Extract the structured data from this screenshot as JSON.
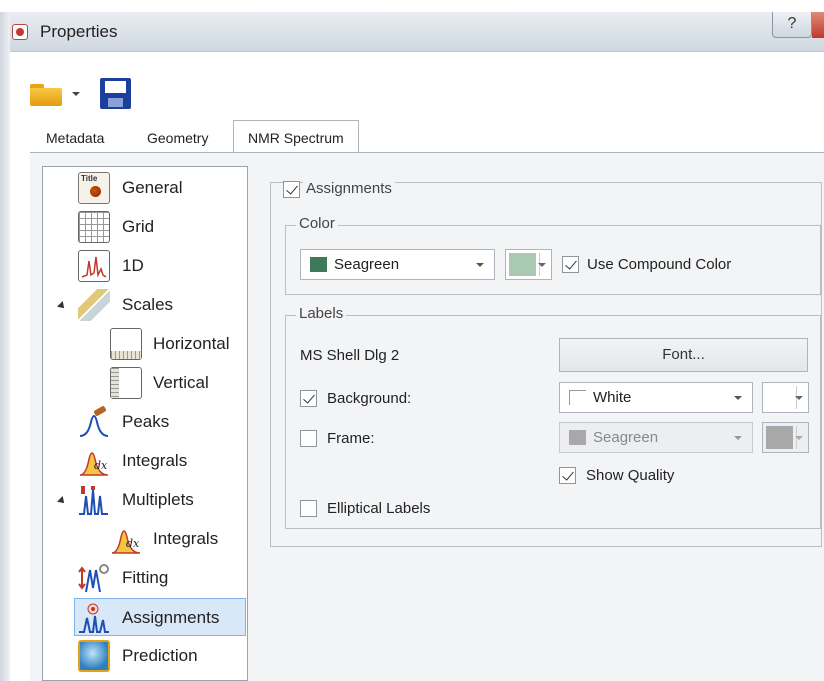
{
  "window": {
    "title": "Properties",
    "help_glyph": "?"
  },
  "toolbar": {
    "open_icon": "folder-open-icon",
    "save_icon": "save-icon"
  },
  "tabs": [
    {
      "label": "Metadata",
      "active": false
    },
    {
      "label": "Geometry",
      "active": false
    },
    {
      "label": "NMR Spectrum",
      "active": true
    }
  ],
  "tree": {
    "items": [
      {
        "label": "General",
        "icon": "title-icon"
      },
      {
        "label": "Grid",
        "icon": "grid-icon"
      },
      {
        "label": "1D",
        "icon": "spectrum-1d-icon"
      },
      {
        "label": "Scales",
        "icon": "rulers-icon",
        "expanded": true
      },
      {
        "label": "Horizontal",
        "icon": "ruler-horizontal-icon"
      },
      {
        "label": "Vertical",
        "icon": "ruler-vertical-icon"
      },
      {
        "label": "Peaks",
        "icon": "peak-pick-icon"
      },
      {
        "label": "Integrals",
        "icon": "integral-icon"
      },
      {
        "label": "Multiplets",
        "icon": "multiplet-icon",
        "expanded": true
      },
      {
        "label": "Integrals",
        "icon": "integral-icon"
      },
      {
        "label": "Fitting",
        "icon": "fitting-icon"
      },
      {
        "label": "Assignments",
        "icon": "assignment-icon",
        "selected": true
      },
      {
        "label": "Prediction",
        "icon": "prediction-icon"
      }
    ]
  },
  "assignments": {
    "label": "Assignments",
    "checked": true,
    "color_group": {
      "title": "Color",
      "color_value": "Seagreen",
      "color_swatch": "#3d7a5a",
      "compound_swatch": "#a9c9b3",
      "use_compound_label": "Use Compound Color",
      "use_compound_checked": true
    },
    "labels_group": {
      "title": "Labels",
      "font_name": "MS Shell Dlg 2",
      "font_button": "Font...",
      "background_label": "Background:",
      "background_checked": true,
      "background_value": "White",
      "background_swatch": "#ffffff",
      "frame_label": "Frame:",
      "frame_checked": false,
      "frame_value": "Seagreen",
      "frame_swatch": "#a8a8a8",
      "show_quality_label": "Show Quality",
      "show_quality_checked": true,
      "elliptical_label": "Elliptical Labels",
      "elliptical_checked": false
    }
  }
}
